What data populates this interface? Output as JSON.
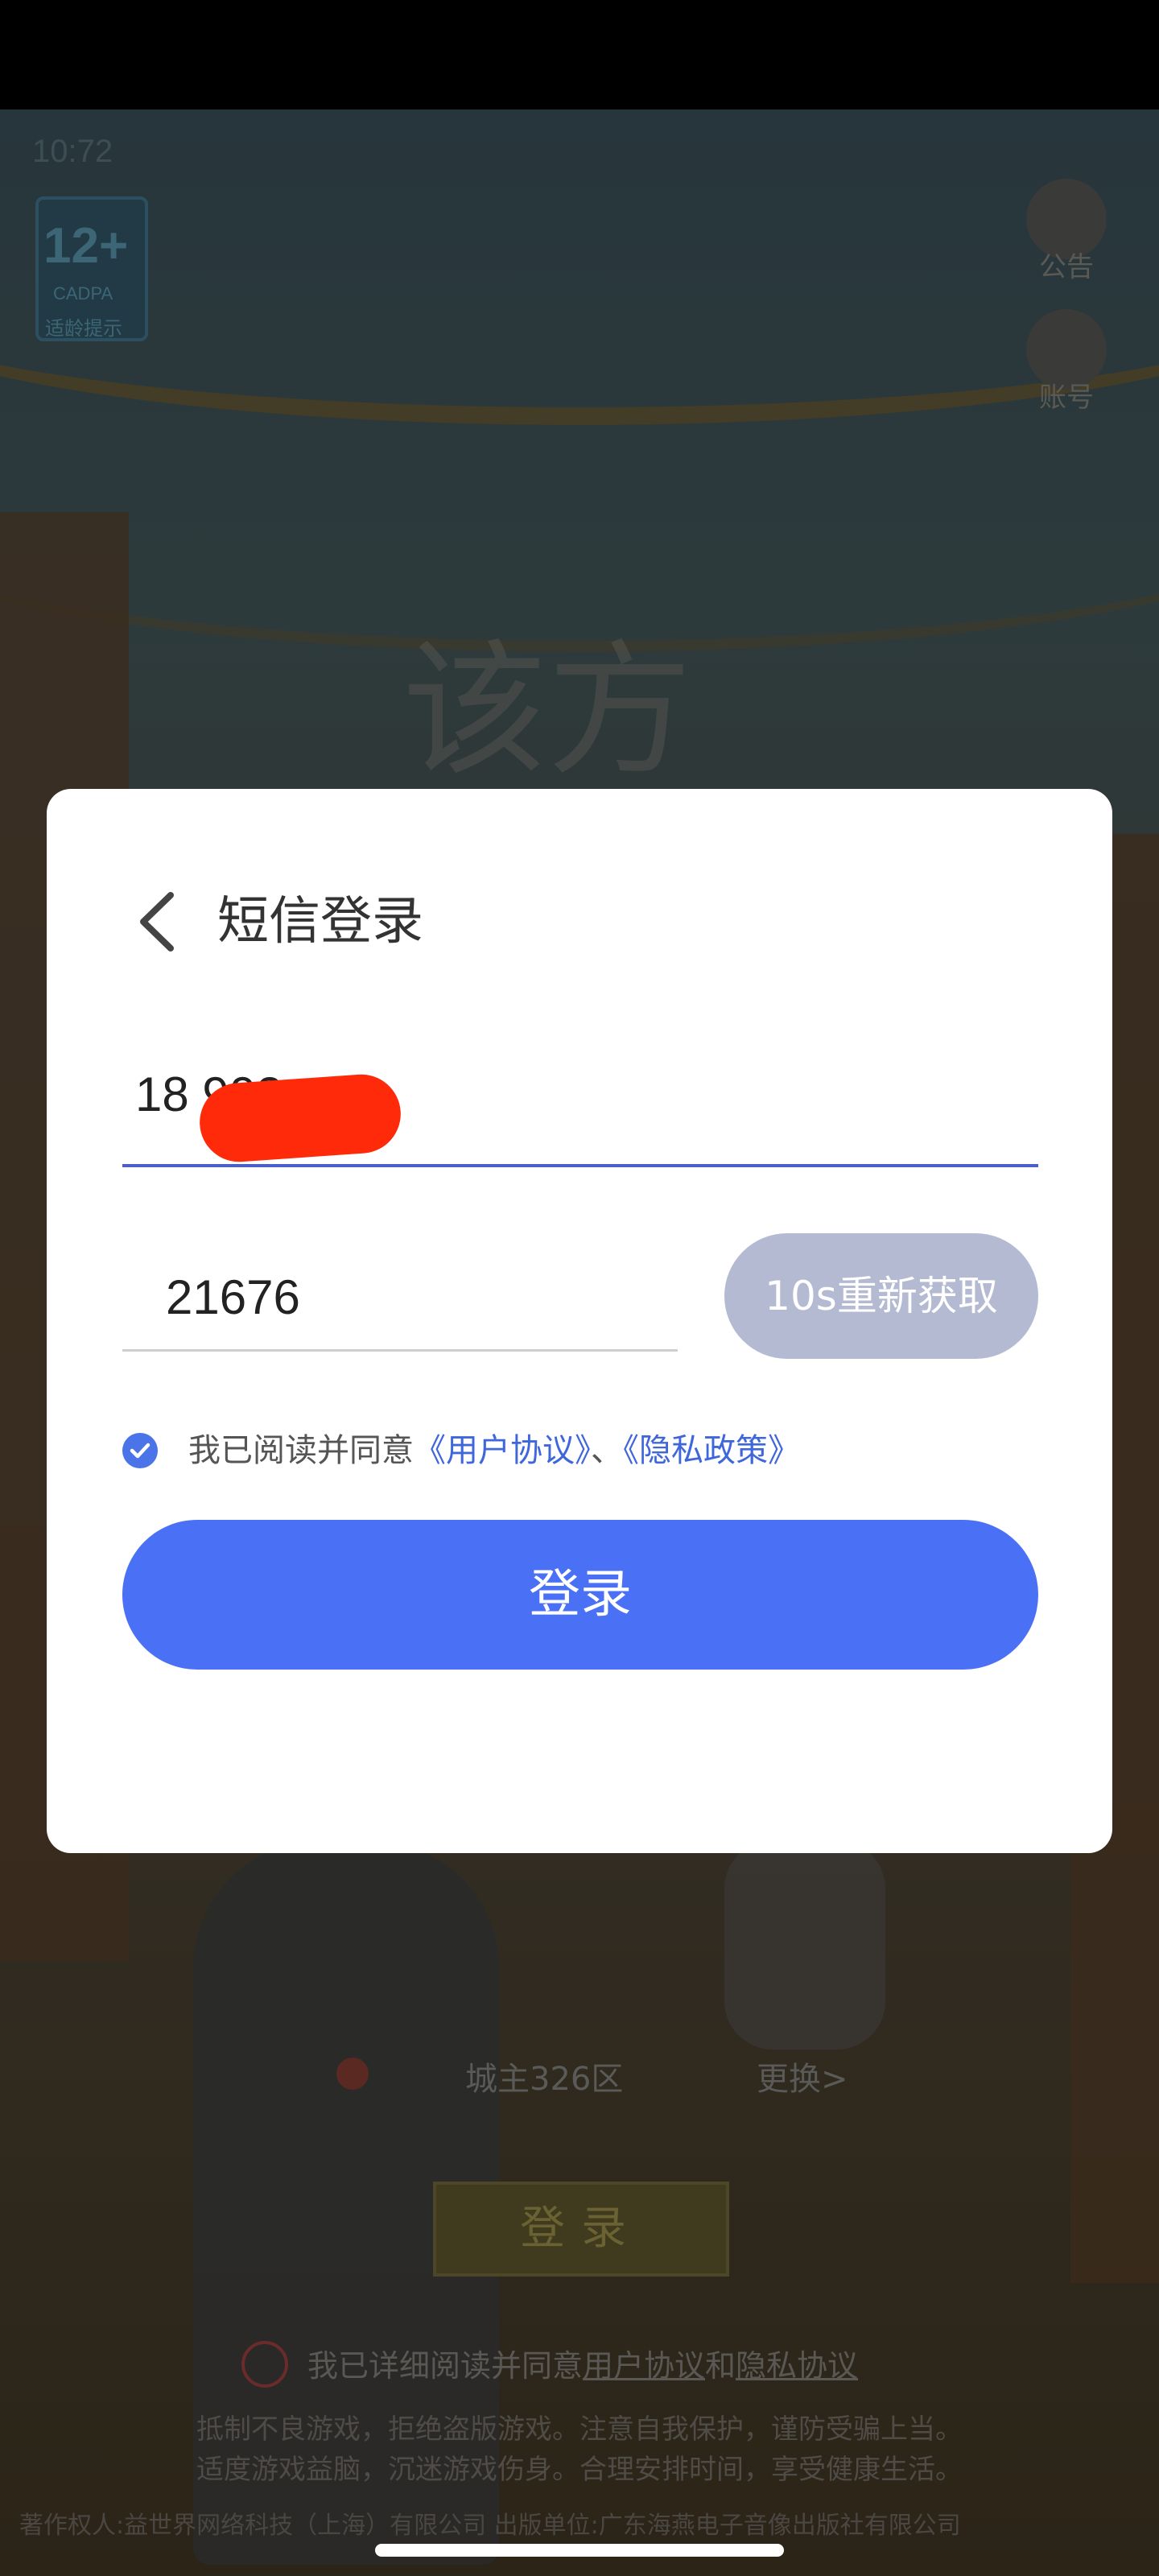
{
  "status_bar": {
    "time": "10:72"
  },
  "age_badge": {
    "rating": "12+",
    "org": "CADPA",
    "label": "适龄提示"
  },
  "side_buttons": {
    "notice_label": "公告",
    "account_label": "账号"
  },
  "background_screen": {
    "calligraphy": "该方",
    "server_name": "城主326区",
    "server_change": "更换>",
    "login_label": "登录",
    "agree_prefix": "我已详细阅读并同意",
    "agree_user": "用户协议",
    "agree_and": "和",
    "agree_privacy": "隐私协议",
    "notice_line1": "抵制不良游戏，拒绝盗版游戏。注意自我保护，谨防受骗上当。",
    "notice_line2": "适度游戏益脑，沉迷游戏伤身。合理安排时间，享受健康生活。",
    "copyright": "著作权人:益世界网络科技（上海）有限公司    出版单位:广东海燕电子音像出版社有限公司"
  },
  "sms_modal": {
    "title": "短信登录",
    "phone_value": "18             902",
    "code_value": "21676",
    "resend_label": "10s重新获取",
    "agree_prefix": "我已阅读并同意",
    "user_agreement": "《用户协议》",
    "separator": "、",
    "privacy_policy": "《隐私政策》",
    "login_label": "登录"
  },
  "colors": {
    "primary_button": "#4a70f5",
    "disabled_button": "#b4bad2",
    "link": "#3f66db",
    "redaction": "#ff2a0a"
  }
}
